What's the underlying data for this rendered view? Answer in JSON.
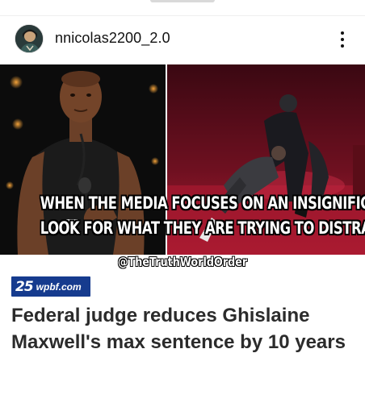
{
  "post": {
    "username": "nnicolas2200_2.0",
    "avatar_icon": "profile-avatar",
    "more_icon": "more-vertical-icon"
  },
  "meme": {
    "line1": "WHEN THE MEDIA FOCUSES ON AN INSIGNIFICANT EVENT,",
    "line2": "LOOK FOR WHAT THEY ARE TRYING TO DISTRACT YOU FROM",
    "watermark": "@TheTruthWorldOrder"
  },
  "news": {
    "logo_number": "25",
    "logo_site": "wpbf.com",
    "headline": "Federal judge reduces Ghislaine Maxwell's max sentence by 10 years"
  },
  "colors": {
    "logo_blue": "#163b8e",
    "headline_text": "#2b2b2b",
    "stage_red": "#8a1426"
  }
}
